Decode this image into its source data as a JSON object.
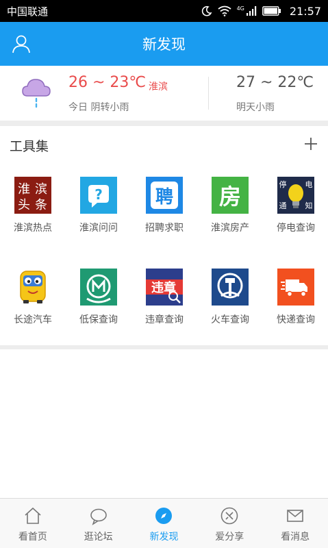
{
  "status_bar": {
    "carrier": "中国联通",
    "network": "4G",
    "time": "21:57"
  },
  "header": {
    "title": "新发现"
  },
  "weather": {
    "today_temp": "26 ~ 23℃",
    "city": "淮滨",
    "today_desc": "今日 阴转小雨",
    "tomorrow_temp": "27 ~ 22℃",
    "tomorrow_desc": "明天小雨"
  },
  "tools": {
    "title": "工具集",
    "add_symbol": "+",
    "items": [
      {
        "label": "淮滨热点",
        "icon_text": [
          "淮",
          "滨",
          "头",
          "条"
        ]
      },
      {
        "label": "淮滨问问",
        "icon_text": "?"
      },
      {
        "label": "招聘求职",
        "icon_text": "聘"
      },
      {
        "label": "淮滨房产",
        "icon_text": "房"
      },
      {
        "label": "停电查询",
        "icon_text": [
          "停",
          "电",
          "通",
          "知"
        ]
      },
      {
        "label": "长途汽车"
      },
      {
        "label": "低保查询"
      },
      {
        "label": "违章查询",
        "icon_text": "违章"
      },
      {
        "label": "火车查询"
      },
      {
        "label": "快递查询"
      }
    ]
  },
  "bottom_nav": {
    "items": [
      {
        "label": "看首页"
      },
      {
        "label": "逛论坛"
      },
      {
        "label": "新发现"
      },
      {
        "label": "爱分享"
      },
      {
        "label": "看消息"
      }
    ],
    "active": "新发现"
  },
  "colors": {
    "brand": "#1a9cf0",
    "temp_today": "#e94b4b",
    "text": "#555555"
  }
}
